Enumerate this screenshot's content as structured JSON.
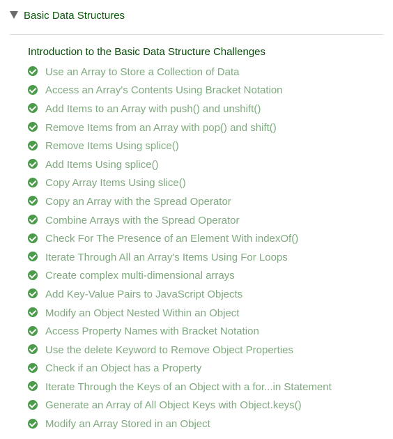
{
  "section": {
    "caret_icon": "caret-down-icon",
    "title": "Basic Data Structures"
  },
  "intro": {
    "label": "Introduction to the Basic Data Structure Challenges"
  },
  "check_icon": "check-circle-icon",
  "colors": {
    "section_title": "#0a5a0a",
    "intro": "#0a4a0a",
    "completed_text": "#7fa97f",
    "check": "#4a9b4a"
  },
  "challenges": [
    {
      "label": "Use an Array to Store a Collection of Data",
      "completed": true
    },
    {
      "label": "Access an Array's Contents Using Bracket Notation",
      "completed": true
    },
    {
      "label": "Add Items to an Array with push() and unshift()",
      "completed": true
    },
    {
      "label": "Remove Items from an Array with pop() and shift()",
      "completed": true
    },
    {
      "label": "Remove Items Using splice()",
      "completed": true
    },
    {
      "label": "Add Items Using splice()",
      "completed": true
    },
    {
      "label": "Copy Array Items Using slice()",
      "completed": true
    },
    {
      "label": "Copy an Array with the Spread Operator",
      "completed": true
    },
    {
      "label": "Combine Arrays with the Spread Operator",
      "completed": true
    },
    {
      "label": "Check For The Presence of an Element With indexOf()",
      "completed": true
    },
    {
      "label": "Iterate Through All an Array's Items Using For Loops",
      "completed": true
    },
    {
      "label": "Create complex multi-dimensional arrays",
      "completed": true
    },
    {
      "label": "Add Key-Value Pairs to JavaScript Objects",
      "completed": true
    },
    {
      "label": "Modify an Object Nested Within an Object",
      "completed": true
    },
    {
      "label": "Access Property Names with Bracket Notation",
      "completed": true
    },
    {
      "label": "Use the delete Keyword to Remove Object Properties",
      "completed": true
    },
    {
      "label": "Check if an Object has a Property",
      "completed": true
    },
    {
      "label": " Iterate Through the Keys of an Object with a for...in Statement",
      "completed": true
    },
    {
      "label": "Generate an Array of All Object Keys with Object.keys()",
      "completed": true
    },
    {
      "label": "Modify an Array Stored in an Object",
      "completed": true
    }
  ]
}
